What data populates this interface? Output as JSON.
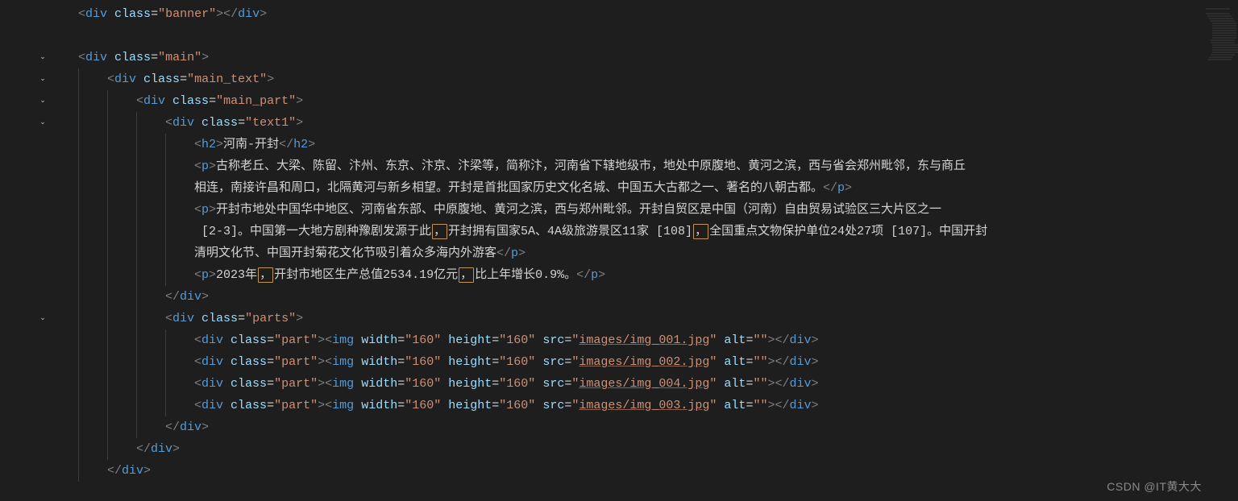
{
  "watermark": "CSDN @IT黄大大",
  "lines": [
    {
      "type": "empty_div",
      "indent": 1,
      "class": "banner"
    },
    {
      "type": "blank"
    },
    {
      "type": "open_div",
      "indent": 1,
      "class": "main"
    },
    {
      "type": "open_div",
      "indent": 2,
      "class": "main_text"
    },
    {
      "type": "open_div",
      "indent": 3,
      "class": "main_part"
    },
    {
      "type": "open_div",
      "indent": 4,
      "class": "text1"
    },
    {
      "type": "h2",
      "indent": 5,
      "text": "河南-开封"
    },
    {
      "type": "p_open_wrap",
      "indent": 5,
      "text": "古称老丘、大梁、陈留、汴州、东京、汴京、汴梁等，简称汴，河南省下辖地级市，地处中原腹地、黄河之滨，西与省会郑州毗邻，东与商丘"
    },
    {
      "type": "wrap_close_p",
      "indent": 5,
      "text": "相连，南接许昌和周口，北隔黄河与新乡相望。开封是首批国家历史文化名城、中国五大古都之一、著名的八朝古都。"
    },
    {
      "type": "p_open_wrap",
      "indent": 5,
      "text": "开封市地处中国华中地区、河南省东部、中原腹地、黄河之滨，西与郑州毗邻。开封自贸区是中国（河南）自由贸易试验区三大片区之一 "
    },
    {
      "type": "wrap_plain",
      "indent": 5,
      "parts": [
        {
          "t": " [2-3]。中国第一大地方剧种豫剧发源于此"
        },
        {
          "hl": "，"
        },
        {
          "t": "开封拥有国家5A、4A级旅游景区11家 [108]"
        },
        {
          "hl": "，"
        },
        {
          "t": "全国重点文物保护单位24处27项 [107]。中国开封"
        }
      ]
    },
    {
      "type": "wrap_close_p",
      "indent": 5,
      "text": "清明文化节、中国开封菊花文化节吸引着众多海内外游客"
    },
    {
      "type": "p_hl_line",
      "indent": 5,
      "parts": [
        {
          "t": "2023年"
        },
        {
          "hl": "，"
        },
        {
          "t": "开封市地区生产总值2534.19亿元"
        },
        {
          "hl": "，"
        },
        {
          "t": "比上年增长0.9%。"
        }
      ]
    },
    {
      "type": "close_div",
      "indent": 4
    },
    {
      "type": "open_div",
      "indent": 4,
      "class": "parts"
    },
    {
      "type": "img_row",
      "indent": 5,
      "class": "part",
      "w": "160",
      "h": "160",
      "src": "images/img_001.jpg"
    },
    {
      "type": "img_row",
      "indent": 5,
      "class": "part",
      "w": "160",
      "h": "160",
      "src": "images/img_002.jpg"
    },
    {
      "type": "img_row",
      "indent": 5,
      "class": "part",
      "w": "160",
      "h": "160",
      "src": "images/img_004.jpg"
    },
    {
      "type": "img_row",
      "indent": 5,
      "class": "part",
      "w": "160",
      "h": "160",
      "src": "images/img_003.jpg"
    },
    {
      "type": "close_div",
      "indent": 4
    },
    {
      "type": "close_div",
      "indent": 3
    },
    {
      "type": "close_div",
      "indent": 2
    }
  ]
}
